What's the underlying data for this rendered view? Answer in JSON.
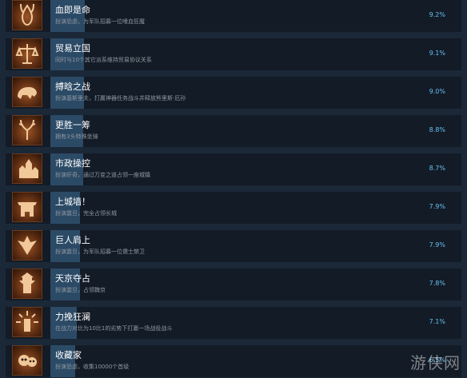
{
  "achievements": [
    {
      "title": "血即是命",
      "desc": "扮演恐虐，为军队招募一位嗜血狂魔",
      "percent": "9.2%",
      "fill": 0.092,
      "icon": "horned-skull-icon"
    },
    {
      "title": "贸易立国",
      "desc": "同时与10个其它派系维持贸易协议关系",
      "percent": "9.1%",
      "fill": 0.091,
      "icon": "scales-icon"
    },
    {
      "title": "搏晗之战",
      "desc": "扮演基斯里夫，打赢神器任务战斗并释放熊里斯·厄孙",
      "percent": "9.0%",
      "fill": 0.09,
      "icon": "bear-icon"
    },
    {
      "title": "更胜一筹",
      "desc": "拥有3头特殊坐骑",
      "percent": "8.8%",
      "fill": 0.088,
      "icon": "antlers-icon"
    },
    {
      "title": "市政操控",
      "desc": "扮演奸奇，通过万变之道占领一座城镇",
      "percent": "8.7%",
      "fill": 0.087,
      "icon": "town-icon"
    },
    {
      "title": "上城墙！",
      "desc": "扮演震旦，完全占领长城",
      "percent": "7.9%",
      "fill": 0.079,
      "icon": "great-wall-icon"
    },
    {
      "title": "巨人肩上",
      "desc": "扮演震旦，为军队招募一位儒士禁卫",
      "percent": "7.9%",
      "fill": 0.079,
      "icon": "crane-icon"
    },
    {
      "title": "天京夺占",
      "desc": "扮演震旦，占领魏京",
      "percent": "7.8%",
      "fill": 0.078,
      "icon": "pagoda-icon"
    },
    {
      "title": "力挽狂澜",
      "desc": "在战力对比为10比1的劣势下打赢一场战役战斗",
      "percent": "7.1%",
      "fill": 0.071,
      "icon": "radiant-tower-icon"
    },
    {
      "title": "收藏家",
      "desc": "扮演恐虐，收集10000个首级",
      "percent": "6.5%",
      "fill": 0.065,
      "icon": "skulls-icon"
    }
  ],
  "watermark": "游侠网"
}
